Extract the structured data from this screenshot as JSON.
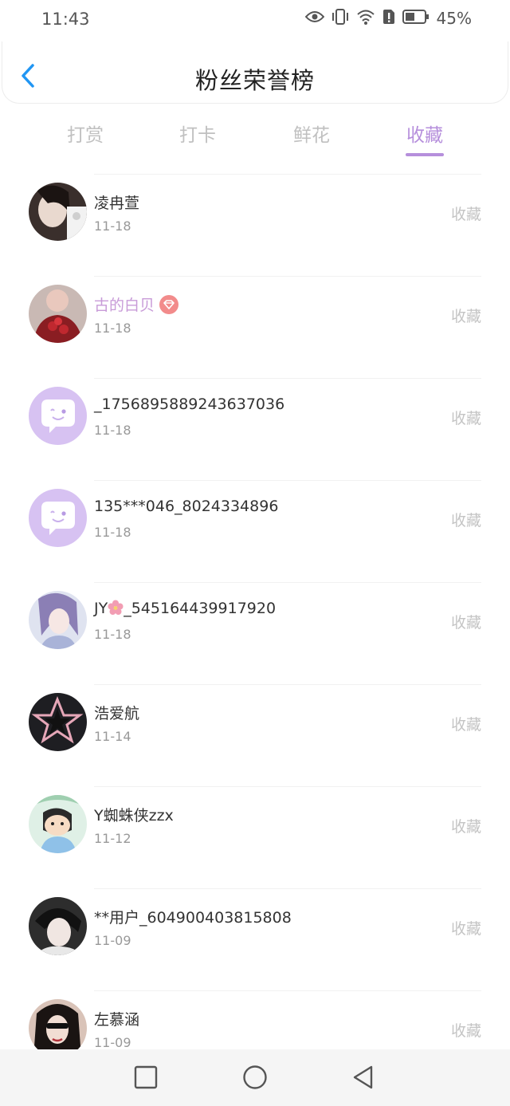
{
  "status": {
    "time": "11:43",
    "battery": "45%"
  },
  "header": {
    "title": "粉丝荣誉榜"
  },
  "tabs": [
    {
      "label": "打赏"
    },
    {
      "label": "打卡"
    },
    {
      "label": "鲜花"
    },
    {
      "label": "收藏"
    }
  ],
  "active_tab": "收藏",
  "fans": [
    {
      "name": "凌冉萱",
      "date": "11-18",
      "action": "收藏"
    },
    {
      "name": "古的白贝",
      "date": "11-18",
      "action": "收藏"
    },
    {
      "name": "_1756895889243637036",
      "date": "11-18",
      "action": "收藏"
    },
    {
      "name": "135***046_8024334896",
      "date": "11-18",
      "action": "收藏"
    },
    {
      "name_prefix": "JY",
      "name_suffix": "_545164439917920",
      "date": "11-18",
      "action": "收藏"
    },
    {
      "name": "浩爱航",
      "date": "11-14",
      "action": "收藏"
    },
    {
      "name": "Y蜘蛛侠zzx",
      "date": "11-12",
      "action": "收藏"
    },
    {
      "name": "**用户_604900403815808",
      "date": "11-09",
      "action": "收藏"
    },
    {
      "name": "左慕涵",
      "date": "11-09",
      "action": "收藏"
    }
  ],
  "colors": {
    "accent": "#b68fdc",
    "vip_name": "#c89bd8",
    "vip_badge": "#f28b8b",
    "default_avatar": "#d7c2f2"
  }
}
